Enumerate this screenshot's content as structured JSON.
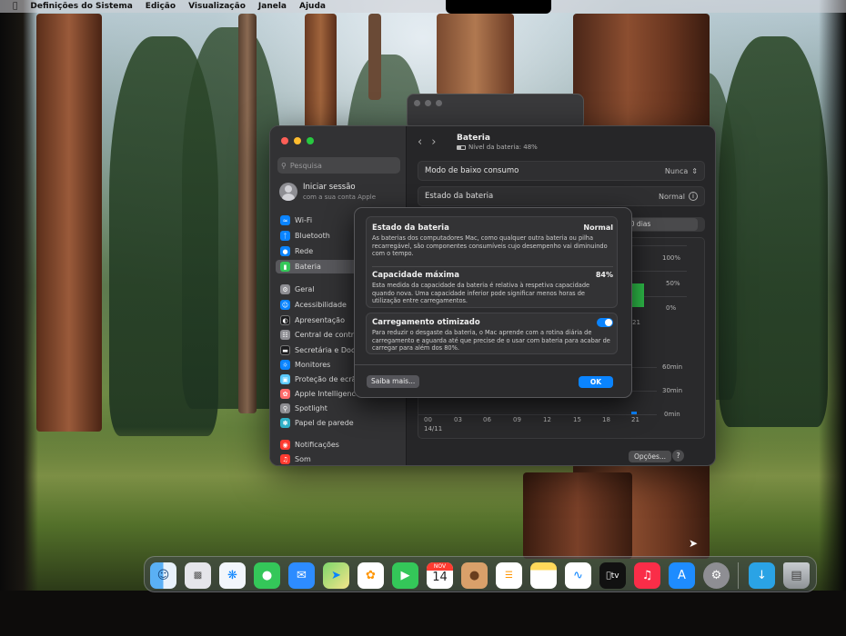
{
  "menubar": {
    "items": [
      "Definições do Sistema",
      "Edição",
      "Visualização",
      "Janela",
      "Ajuda"
    ]
  },
  "sidebar": {
    "search_placeholder": "Pesquisa",
    "account": {
      "title": "Iniciar sessão",
      "subtitle": "com a sua conta Apple"
    },
    "items": [
      {
        "label": "Wi-Fi",
        "icon": "wifi-icon",
        "color": "#0a84ff"
      },
      {
        "label": "Bluetooth",
        "icon": "bluetooth-icon",
        "color": "#0a84ff"
      },
      {
        "label": "Rede",
        "icon": "globe-icon",
        "color": "#0a84ff"
      },
      {
        "label": "Bateria",
        "icon": "battery-icon",
        "color": "#34c759"
      },
      {
        "label": "Geral",
        "icon": "gear-icon",
        "color": "#8e8e93"
      },
      {
        "label": "Acessibilidade",
        "icon": "accessibility-icon",
        "color": "#0a84ff"
      },
      {
        "label": "Apresentação",
        "icon": "appearance-icon",
        "color": "#1c1c1e"
      },
      {
        "label": "Central de contro",
        "icon": "control-center-icon",
        "color": "#8e8e93"
      },
      {
        "label": "Secretária e Dock",
        "icon": "dock-icon",
        "color": "#1c1c1e"
      },
      {
        "label": "Monitores",
        "icon": "display-icon",
        "color": "#0a84ff"
      },
      {
        "label": "Proteção de ecrã",
        "icon": "screensaver-icon",
        "color": "#5ac8fa"
      },
      {
        "label": "Apple Intelligence",
        "icon": "apple-intelligence-icon",
        "color": "#ff6b6b"
      },
      {
        "label": "Spotlight",
        "icon": "spotlight-icon",
        "color": "#8e8e93"
      },
      {
        "label": "Papel de parede",
        "icon": "wallpaper-icon",
        "color": "#30b0c7"
      },
      {
        "label": "Notificações",
        "icon": "notifications-icon",
        "color": "#ff3b30"
      },
      {
        "label": "Som",
        "icon": "sound-icon",
        "color": "#ff3b30"
      }
    ]
  },
  "content": {
    "title": "Bateria",
    "subtitle": "Nível da bateria: 48%",
    "low_power": {
      "label": "Modo de baixo consumo",
      "value": "Nunca"
    },
    "health": {
      "label": "Estado da bateria",
      "value": "Normal"
    },
    "range_label": "10 dias",
    "level_ticks": [
      "100%",
      "50%",
      "0%"
    ],
    "usage_ticks": [
      "60min",
      "30min",
      "0min"
    ],
    "hour_ticks": [
      "00",
      "03",
      "06",
      "09",
      "12",
      "15",
      "18",
      "21"
    ],
    "date_label": "14/11",
    "upper_tick": "21",
    "options_label": "Opções...",
    "help_label": "?"
  },
  "sheet": {
    "health": {
      "title": "Estado da bateria",
      "value": "Normal",
      "desc": "As baterias dos computadores Mac, como qualquer outra bateria ou pilha recarregável, são componentes consumíveis cujo desempenho vai diminuindo com o tempo."
    },
    "capacity": {
      "title": "Capacidade máxima",
      "value": "84%",
      "desc": "Esta medida da capacidade da bateria é relativa à respetiva capacidade quando nova. Uma capacidade inferior pode significar menos horas de utilização entre carregamentos."
    },
    "optimized": {
      "title": "Carregamento otimizado",
      "enabled": true,
      "desc": "Para reduzir o desgaste da bateria, o Mac aprende com a rotina diária de carregamento e aguarda até que precise de o usar com bateria para acabar de carregar para além dos 80%."
    },
    "more_label": "Saiba mais...",
    "ok_label": "OK"
  },
  "dock": {
    "calendar_month": "NOV",
    "calendar_day": "14",
    "apps": [
      "finder",
      "launchpad",
      "safari",
      "messages",
      "mail",
      "maps",
      "photos",
      "facetime",
      "calendar",
      "contacts",
      "reminders",
      "notes",
      "freeform",
      "tv",
      "music",
      "app-store",
      "system-settings",
      "downloads",
      "trash"
    ],
    "tv_label": "tv"
  },
  "colors": {
    "accent": "#0a84ff",
    "chart_green": "#2fc14a",
    "window_bg": "#262628",
    "sidebar_bg": "#323234"
  }
}
